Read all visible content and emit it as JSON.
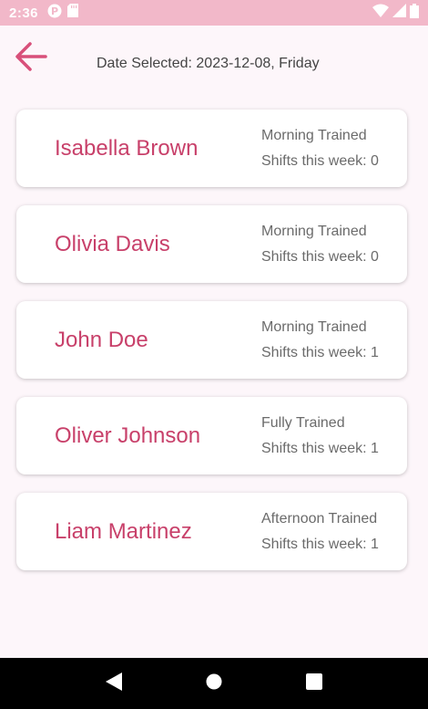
{
  "status_bar": {
    "time": "2:36"
  },
  "header": {
    "date_selected": "Date Selected: 2023-12-08, Friday"
  },
  "employees": [
    {
      "name": "Isabella Brown",
      "training": "Morning Trained",
      "shifts": "Shifts this week: 0"
    },
    {
      "name": "Olivia Davis",
      "training": "Morning Trained",
      "shifts": "Shifts this week: 0"
    },
    {
      "name": "John Doe",
      "training": "Morning Trained",
      "shifts": "Shifts this week: 1"
    },
    {
      "name": "Oliver Johnson",
      "training": "Fully Trained",
      "shifts": "Shifts this week: 1"
    },
    {
      "name": "Liam Martinez",
      "training": "Afternoon Trained",
      "shifts": "Shifts this week: 1"
    }
  ],
  "colors": {
    "accent": "#c8406a",
    "status_bar": "#f2b8c9",
    "background": "#fdf6fa"
  },
  "icons": {
    "back": "arrow-left-icon",
    "nav_back": "triangle-back-icon",
    "nav_home": "circle-home-icon",
    "nav_recents": "square-recents-icon"
  }
}
